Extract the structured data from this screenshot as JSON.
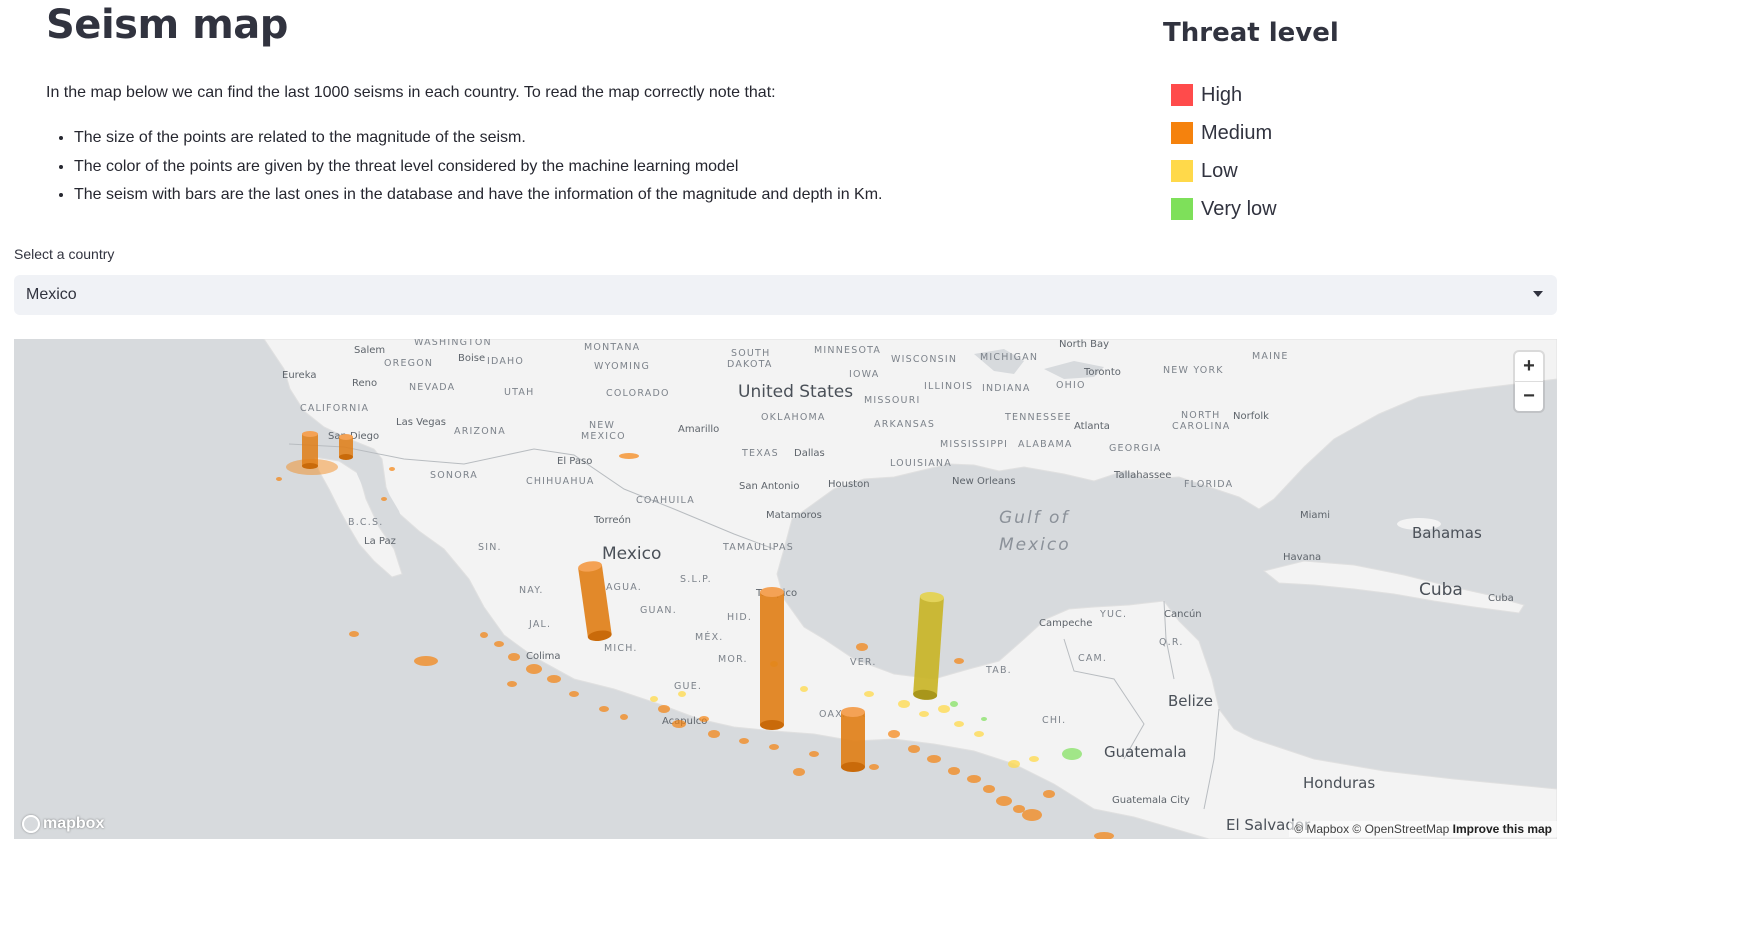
{
  "page": {
    "title": "Seism map",
    "intro": "In the map below we can find the last 1000 seisms in each country. To read the map correctly note that:",
    "bullets": [
      "The size of the points are related to the magnitude of the seism.",
      "The color of the points are given by the threat level considered by the machine learning model",
      "The seism with bars are the last ones in the database and have the information of the magnitude and depth in Km."
    ]
  },
  "legend": {
    "title": "Threat level",
    "items": [
      {
        "label": "High",
        "color": "#ff4b4b"
      },
      {
        "label": "Medium",
        "color": "#f5820d"
      },
      {
        "label": "Low",
        "color": "#ffd94a"
      },
      {
        "label": "Very low",
        "color": "#7ee05a"
      }
    ]
  },
  "country_select": {
    "label": "Select a country",
    "selected": "Mexico"
  },
  "map": {
    "zoom_in": "+",
    "zoom_out": "−",
    "logo": "mapbox",
    "attribution": "© Mapbox © OpenStreetMap",
    "improve_link": "Improve this map",
    "labels": {
      "united_states": "United States",
      "mexico": "Mexico",
      "gulf_line1": "Gulf of",
      "gulf_line2": "Mexico",
      "cuba": "Cuba",
      "cuba_small": "Cuba",
      "bahamas": "Bahamas",
      "belize": "Belize",
      "guatemala": "Guatemala",
      "honduras": "Honduras",
      "el_salvador": "El Salvador",
      "guatemala_city": "Guatemala City",
      "havana": "Havana",
      "miami": "Miami",
      "campeche": "Campeche",
      "cancun": "Cancún",
      "acapulco": "Acapulco",
      "colima": "Colima",
      "torreon": "Torreón",
      "matamoros": "Matamoros",
      "houston": "Houston",
      "san_antonio": "San Antonio",
      "dallas": "Dallas",
      "new_orleans": "New Orleans",
      "atlanta": "Atlanta",
      "el_paso": "El Paso",
      "amarillo": "Amarillo",
      "las_vegas": "Las Vegas",
      "san_diego": "San Diego",
      "la_paz": "La Paz",
      "reno": "Reno",
      "eureka": "Eureka",
      "salem": "Salem",
      "boise": "Boise",
      "tallahassee": "Tallahassee",
      "norfolk": "Norfolk",
      "toronto": "Toronto",
      "north_bay": "North Bay",
      "tampico": "Tampico",
      "washington": "WASHINGTON",
      "oregon": "OREGON",
      "idaho": "IDAHO",
      "montana": "MONTANA",
      "wyoming": "WYOMING",
      "nevada": "NEVADA",
      "utah": "UTAH",
      "colorado": "COLORADO",
      "california": "CALIFORNIA",
      "arizona": "ARIZONA",
      "new_mexico_l1": "NEW",
      "new_mexico_l2": "MEXICO",
      "south_dakota_l1": "SOUTH",
      "south_dakota_l2": "DAKOTA",
      "minnesota": "MINNESOTA",
      "wisconsin": "WISCONSIN",
      "michigan": "MICHIGAN",
      "iowa": "IOWA",
      "illinois": "ILLINOIS",
      "indiana": "INDIANA",
      "ohio": "OHIO",
      "missouri": "MISSOURI",
      "oklahoma": "OKLAHOMA",
      "arkansas": "ARKANSAS",
      "tennessee": "TENNESSEE",
      "texas": "TEXAS",
      "louisiana": "LOUISIANA",
      "mississippi": "MISSISSIPPI",
      "alabama": "ALABAMA",
      "georgia": "GEORGIA",
      "florida": "FLORIDA",
      "north_carolina_l1": "NORTH",
      "north_carolina_l2": "CAROLINA",
      "new_york": "NEW YORK",
      "maine": "MAINE",
      "sonora": "SONORA",
      "chihuahua": "CHIHUAHUA",
      "coahuila": "COAHUILA",
      "tamaulipas": "TAMAULIPAS",
      "bcs": "B.C.S.",
      "sin": "SIN.",
      "nay": "NAY.",
      "jal": "JAL.",
      "mich": "MICH.",
      "gue": "GUE.",
      "oax": "OAXACA",
      "ver": "VER.",
      "tab": "TAB.",
      "chi": "CHI.",
      "yuc": "YUC.",
      "qr": "Q.R.",
      "cam": "CAM.",
      "slp": "S.L.P.",
      "guan": "GUAN.",
      "hid": "HID.",
      "mex": "MÉX.",
      "mor": "MOR.",
      "agua": "AGUA."
    }
  }
}
